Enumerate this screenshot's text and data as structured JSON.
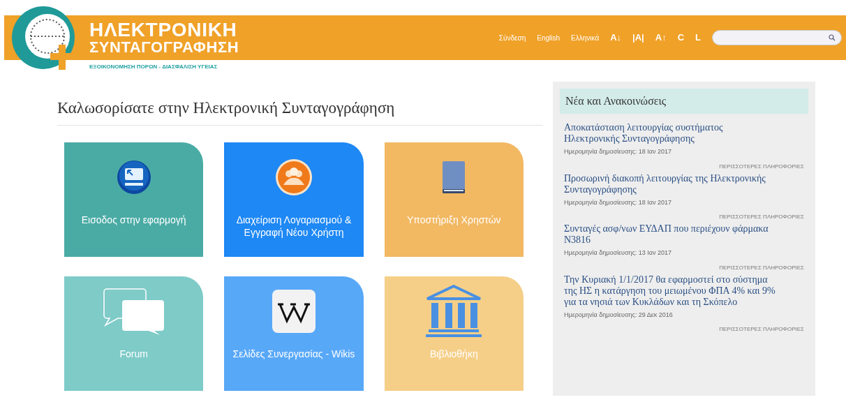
{
  "header": {
    "logo": {
      "line1": "ΗΛΕΚΤΡΟΝΙΚΗ",
      "line2": "ΣΥΝΤΑΓΟΓΡΑΦΗΣΗ",
      "tagline": "ΕΞΟΙΚΟΝΟΜΗΣΗ ΠΟΡΩΝ - ΔΙΑΣΦΑΛΙΣΗ ΥΓΕΙΑΣ"
    },
    "links": [
      "Σύνδεση",
      "English",
      "Ελληνικά"
    ],
    "tools": [
      "A↓",
      "|A|",
      "A↑",
      "C",
      "L"
    ]
  },
  "welcome": {
    "title": "Καλωσορίσατε στην Ηλεκτρονική Συνταγογράφηση"
  },
  "tiles": [
    {
      "label": "Εισοδος στην εφαρμογή",
      "kind": "computer",
      "color": "#4aaba5"
    },
    {
      "label": "Διαχείριση Λογαριασμού & Εγγραφή Νέου Χρήστη",
      "kind": "users",
      "color": "#1e88f5"
    },
    {
      "label": "Υποστήριξη Χρηστών",
      "kind": "book",
      "color": "#f2b862"
    },
    {
      "label": "Forum",
      "kind": "chat",
      "color": "#7ecbc8"
    },
    {
      "label": "Σελίδες Συνεργασίας - Wikis",
      "kind": "wiki",
      "color": "#58a8f8"
    },
    {
      "label": "Βιβλιοθήκη",
      "kind": "library",
      "color": "#f5cf88"
    }
  ],
  "news": {
    "title": "Νέα και Ανακοινώσεις",
    "items": [
      {
        "headline": "Αποκατάσταση λειτουργίας συστήματος Ηλεκτρονικής Συνταγογράφησης",
        "date": "Ημερομηνία δημοσίευσης: 18 Ιαν 2017",
        "more": "ΠΕΡΙΣΣΟΤΕΡΕΣ ΠΛΗΡΟΦΟΡΙΕΣ"
      },
      {
        "headline": "Προσωρινή διακοπή λειτουργίας της Ηλεκτρονικής Συνταγογράφησης",
        "date": "Ημερομηνία δημοσίευσης: 18 Ιαν 2017",
        "more": "ΠΕΡΙΣΣΟΤΕΡΕΣ ΠΛΗΡΟΦΟΡΙΕΣ"
      },
      {
        "headline": "Συνταγές ασφ/νων ΕΥΔΑΠ που περιέχουν φάρμακα Ν3816",
        "date": "Ημερομηνία δημοσίευσης: 13 Ιαν 2017",
        "more": "ΠΕΡΙΣΣΟΤΕΡΕΣ ΠΛΗΡΟΦΟΡΙΕΣ"
      },
      {
        "headline": "Την Κυριακή 1/1/2017 θα εφαρμοστεί στο σύστημα της ΗΣ η κατάργηση του μειωμένου ΦΠΑ 4% και 9% για τα νησιά των Κυκλάδων και τη Σκόπελο",
        "date": "Ημερομηνία δημοσίευσης: 29 Δεκ 2016",
        "more": "ΠΕΡΙΣΣΟΤΕΡΕΣ ΠΛΗΡΟΦΟΡΙΕΣ"
      }
    ]
  }
}
